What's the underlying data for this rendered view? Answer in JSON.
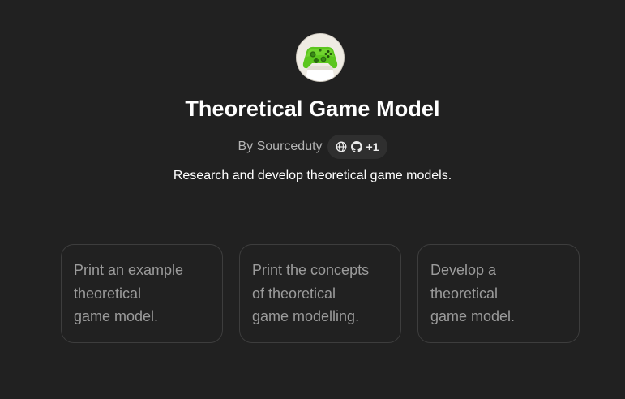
{
  "gpt": {
    "title": "Theoretical Game Model",
    "author": "By Sourceduty",
    "badge_more": "+1",
    "description": "Research and develop theoretical game models."
  },
  "icons": {
    "avatar": "green-game-controller-icon",
    "badge": [
      "globe-icon",
      "github-icon"
    ]
  },
  "starters": [
    {
      "label": "Print an example\ntheoretical\ngame model."
    },
    {
      "label": "Print the concepts\nof theoretical\ngame modelling."
    },
    {
      "label": "Develop a\ntheoretical\ngame model."
    }
  ],
  "colors": {
    "background": "#212121",
    "card_border": "#3d3d3d",
    "controller_green": "#5cc61e"
  }
}
